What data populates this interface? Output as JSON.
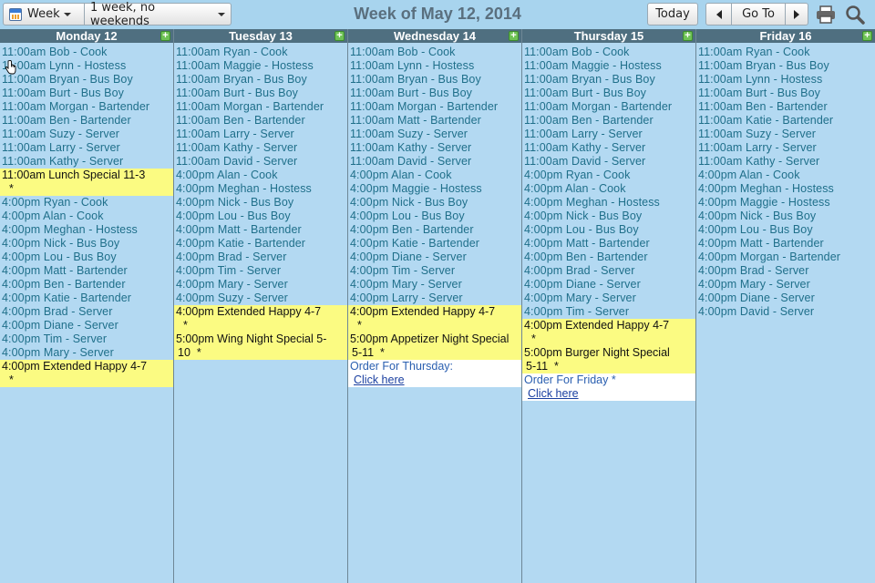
{
  "toolbar": {
    "view_label": "Week",
    "range_label": "1 week, no weekends",
    "title": "Week of May 12, 2014",
    "today_label": "Today",
    "goto_label": "Go To"
  },
  "days": [
    {
      "header": "Monday 12",
      "events": [
        "11:00am Bob - Cook",
        "11:00am Lynn - Hostess",
        "11:00am Bryan - Bus Boy",
        "11:00am Burt - Bus Boy",
        "11:00am Morgan - Bartender",
        "11:00am Ben - Bartender",
        "11:00am Suzy - Server",
        "11:00am Larry - Server",
        "11:00am Kathy - Server"
      ],
      "special1": "11:00am Lunch Special 11-3",
      "events2": [
        "4:00pm Ryan - Cook",
        "4:00pm Alan - Cook",
        "4:00pm Meghan - Hostess",
        "4:00pm Nick - Bus Boy",
        "4:00pm Lou - Bus Boy",
        "4:00pm Matt - Bartender",
        "4:00pm Ben - Bartender",
        "4:00pm Katie - Bartender",
        "4:00pm Brad - Server",
        "4:00pm Diane - Server",
        "4:00pm Tim - Server",
        "4:00pm Mary - Server"
      ],
      "special2": "4:00pm Extended Happy 4-7"
    },
    {
      "header": "Tuesday 13",
      "events": [
        "11:00am Ryan - Cook",
        "11:00am Maggie - Hostess",
        "11:00am Bryan - Bus Boy",
        "11:00am Burt - Bus Boy",
        "11:00am Morgan - Bartender",
        "11:00am Ben - Bartender",
        "11:00am Larry - Server",
        "11:00am Kathy - Server",
        "11:00am David - Server",
        "4:00pm Alan - Cook",
        "4:00pm Meghan - Hostess",
        "4:00pm Nick - Bus Boy",
        "4:00pm Lou - Bus Boy",
        "4:00pm Matt - Bartender",
        "4:00pm Katie - Bartender",
        "4:00pm Brad - Server",
        "4:00pm Tim - Server",
        "4:00pm Mary - Server",
        "4:00pm Suzy - Server"
      ],
      "special1": "4:00pm Extended Happy 4-7",
      "special2_line1": "5:00pm Wing Night Special 5-",
      "special2_line2": "10"
    },
    {
      "header": "Wednesday 14",
      "events": [
        "11:00am Bob - Cook",
        "11:00am Lynn - Hostess",
        "11:00am Bryan - Bus Boy",
        "11:00am Burt - Bus Boy",
        "11:00am Morgan - Bartender",
        "11:00am Matt - Bartender",
        "11:00am Suzy - Server",
        "11:00am Kathy - Server",
        "11:00am David - Server",
        "4:00pm Alan - Cook",
        "4:00pm Maggie - Hostess",
        "4:00pm Nick - Bus Boy",
        "4:00pm Lou - Bus Boy",
        "4:00pm Ben - Bartender",
        "4:00pm Katie - Bartender",
        "4:00pm Diane - Server",
        "4:00pm Tim - Server",
        "4:00pm Mary - Server",
        "4:00pm Larry - Server"
      ],
      "special1": "4:00pm Extended Happy 4-7",
      "special2_line1": "5:00pm Appetizer Night Special",
      "special2_line2": "5-11",
      "note_title": "Order For Thursday:",
      "note_link": "Click here"
    },
    {
      "header": "Thursday 15",
      "events": [
        "11:00am Bob - Cook",
        "11:00am Maggie - Hostess",
        "11:00am Bryan - Bus Boy",
        "11:00am Burt - Bus Boy",
        "11:00am Morgan - Bartender",
        "11:00am Ben - Bartender",
        "11:00am Larry - Server",
        "11:00am Kathy - Server",
        "11:00am David - Server",
        "4:00pm Ryan - Cook",
        "4:00pm Alan - Cook",
        "4:00pm Meghan - Hostess",
        "4:00pm Nick - Bus Boy",
        "4:00pm Lou - Bus Boy",
        "4:00pm Matt - Bartender",
        "4:00pm Ben - Bartender",
        "4:00pm Brad - Server",
        "4:00pm Diane - Server",
        "4:00pm Mary - Server",
        "4:00pm Tim - Server"
      ],
      "special1": "4:00pm Extended Happy 4-7",
      "special2_line1": "5:00pm Burger Night Special",
      "special2_line2": "5-11",
      "note_title": "Order For Friday *",
      "note_link": "Click here"
    },
    {
      "header": "Friday 16",
      "events": [
        "11:00am Ryan - Cook",
        "11:00am Bryan - Bus Boy",
        "11:00am Lynn - Hostess",
        "11:00am Burt - Bus Boy",
        "11:00am Ben - Bartender",
        "11:00am Katie - Bartender",
        "11:00am Suzy - Server",
        "11:00am Larry - Server",
        "11:00am Kathy - Server",
        "4:00pm Alan - Cook",
        "4:00pm Meghan - Hostess",
        "4:00pm Maggie - Hostess",
        "4:00pm Nick - Bus Boy",
        "4:00pm Lou - Bus Boy",
        "4:00pm Matt - Bartender",
        "4:00pm Morgan - Bartender",
        "4:00pm Brad - Server",
        "4:00pm Mary - Server",
        "4:00pm Diane - Server",
        "4:00pm David - Server"
      ]
    }
  ],
  "star": "*",
  "add_symbol": "+",
  "colors": {
    "background": "#b3d9f2",
    "header": "#4f6f80",
    "event_text": "#1f6f8a",
    "special_bg": "#fbfb82",
    "add_icon": "#6ec255"
  }
}
